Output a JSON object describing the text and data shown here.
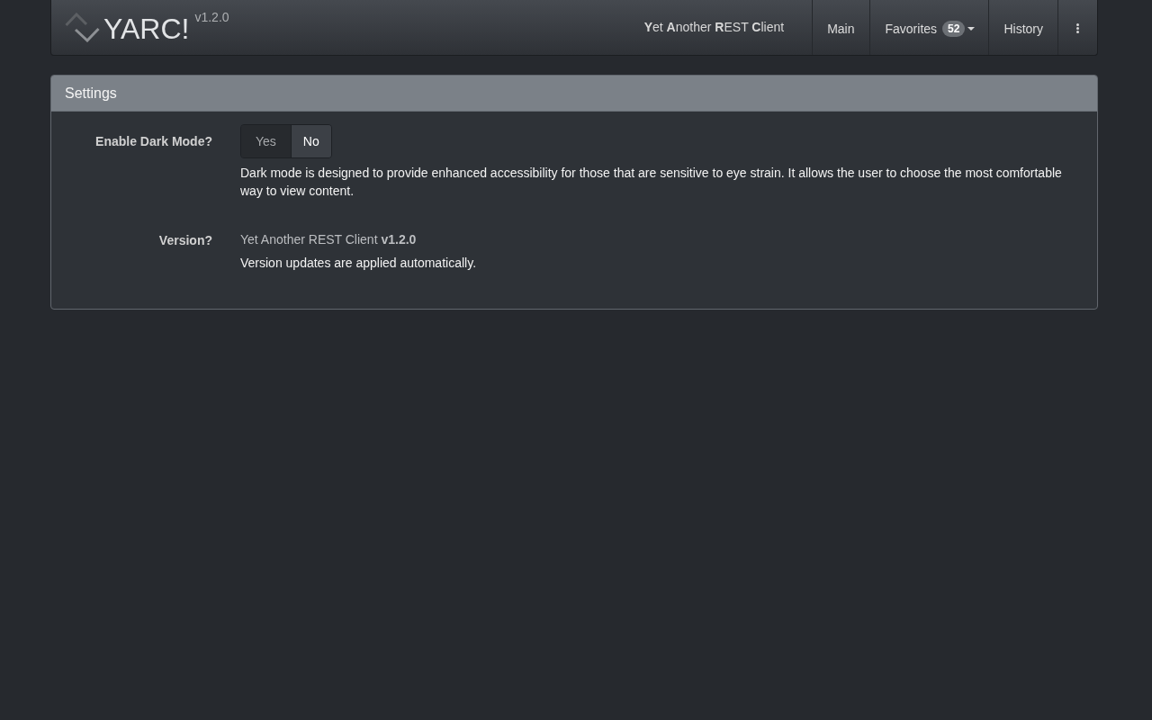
{
  "navbar": {
    "brand": "YARC!",
    "version": "v1.2.0",
    "tagline": "**Y**et **A**nother **R**EST **C**lient",
    "items": [
      {
        "kind": "link",
        "label": "Main"
      },
      {
        "kind": "dropdown",
        "label": "Favorites",
        "badge": "52"
      },
      {
        "kind": "link",
        "label": "History"
      },
      {
        "kind": "menu"
      }
    ]
  },
  "panel": {
    "title": "Settings",
    "settings": [
      {
        "kind": "toggle",
        "label": "Enable Dark Mode?",
        "options": [
          {
            "label": "Yes",
            "selected": false
          },
          {
            "label": "No",
            "selected": true
          }
        ],
        "help": "Dark mode is designed to provide enhanced accessibility for those that are sensitive to eye strain. It allows the user to choose the most comfortable way to view content."
      },
      {
        "kind": "info",
        "label": "Version?",
        "value": "Yet Another REST Client **v1.2.0**",
        "help": "Version updates are applied automatically."
      }
    ]
  }
}
